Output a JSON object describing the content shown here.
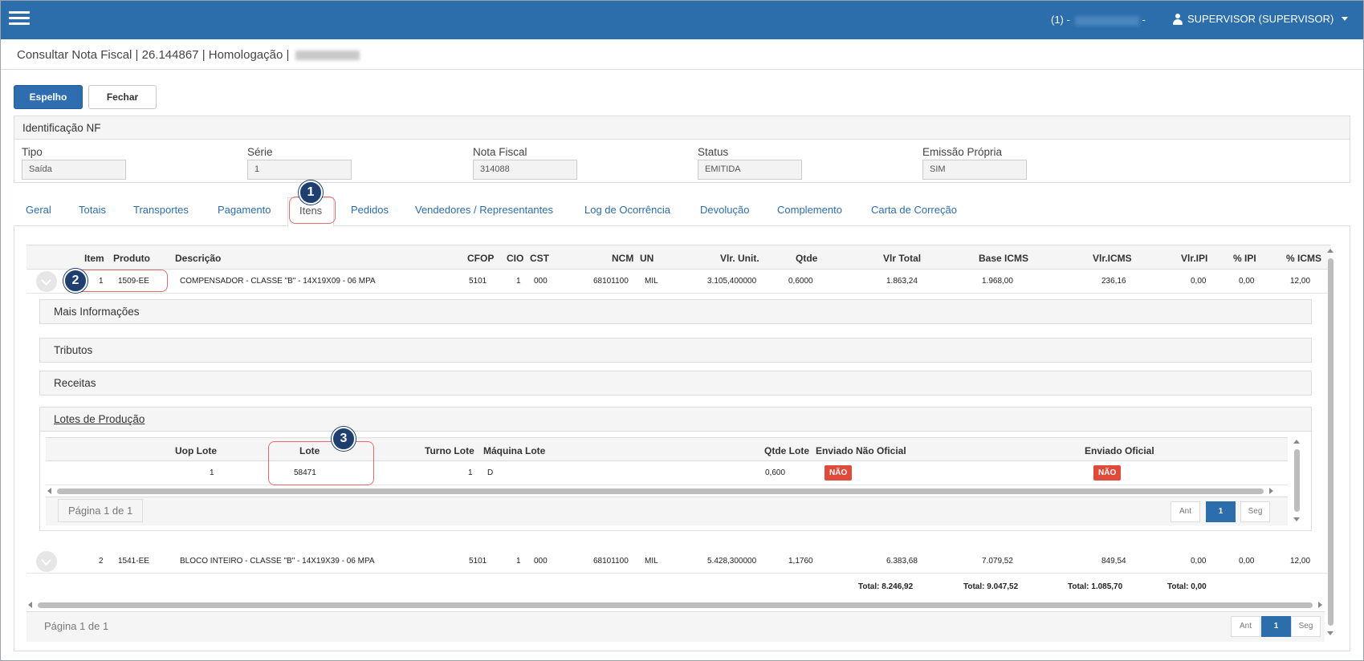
{
  "header": {
    "company_prefix": "(1) -",
    "company_suffix": "-",
    "user": "SUPERVISOR (SUPERVISOR)"
  },
  "title": {
    "text": "Consultar Nota Fiscal | 26.144867 | Homologação |"
  },
  "toolbar": {
    "espelho": "Espelho",
    "fechar": "Fechar"
  },
  "identificacao": {
    "heading": "Identificação NF",
    "fields": [
      {
        "label": "Tipo",
        "value": "Saída"
      },
      {
        "label": "Série",
        "value": "1"
      },
      {
        "label": "Nota Fiscal",
        "value": "314088"
      },
      {
        "label": "Status",
        "value": "EMITIDA"
      },
      {
        "label": "Emissão Própria",
        "value": "SIM"
      }
    ]
  },
  "tabs": [
    "Geral",
    "Totais",
    "Transportes",
    "Pagamento",
    "Itens",
    "Pedidos",
    "Vendedores / Representantes",
    "Log de Ocorrência",
    "Devolução",
    "Complemento",
    "Carta de Correção"
  ],
  "markers": [
    "1",
    "2",
    "3"
  ],
  "items": {
    "columns": [
      "Item",
      "Produto",
      "Descrição",
      "CFOP",
      "CIO",
      "CST",
      "NCM",
      "UN",
      "Vlr. Unit.",
      "Qtde",
      "Vlr Total",
      "Base ICMS",
      "Vlr.ICMS",
      "Vlr.IPI",
      "% IPI",
      "% ICMS"
    ],
    "rows": [
      {
        "item": "1",
        "produto": "1509-EE",
        "descricao": "COMPENSADOR - CLASSE \"B\" - 14X19X09 - 06 MPA",
        "cfop": "5101",
        "cio": "1",
        "cst": "000",
        "ncm": "68101100",
        "un": "MIL",
        "vlr_unit": "3.105,400000",
        "qtde": "0,6000",
        "vlr_total": "1.863,24",
        "base_icms": "1.968,00",
        "vlr_icms": "236,16",
        "vlr_ipi": "0,00",
        "pct_ipi": "0,00",
        "pct_icms": "12,00"
      },
      {
        "item": "2",
        "produto": "1541-EE",
        "descricao": "BLOCO INTEIRO - CLASSE \"B\" - 14X19X39 - 06 MPA",
        "cfop": "5101",
        "cio": "1",
        "cst": "000",
        "ncm": "68101100",
        "un": "MIL",
        "vlr_unit": "5.428,300000",
        "qtde": "1,1760",
        "vlr_total": "6.383,68",
        "base_icms": "7.079,52",
        "vlr_icms": "849,54",
        "vlr_ipi": "0,00",
        "pct_ipi": "0,00",
        "pct_icms": "12,00"
      }
    ],
    "totals": {
      "vlr_total": "Total: 8.246,92",
      "base_icms": "Total: 9.047,52",
      "vlr_icms": "Total: 1.085,70",
      "vlr_ipi": "Total: 0,00"
    },
    "accordions": [
      "Mais Informações",
      "Tributos",
      "Receitas"
    ],
    "page_info": "Página 1 de 1",
    "pager": {
      "prev": "Ant",
      "current": "1",
      "next": "Seg"
    }
  },
  "lotes": {
    "heading": "Lotes de Produção",
    "columns": [
      "Uop Lote",
      "Lote",
      "Turno Lote",
      "Máquina Lote",
      "Qtde Lote",
      "Enviado Não Oficial",
      "Enviado Oficial"
    ],
    "row": {
      "uop": "1",
      "lote": "58471",
      "turno": "1",
      "maquina": "D",
      "qtde": "0,600",
      "nao_oficial": "NÃO",
      "oficial": "NÃO"
    },
    "page_info": "Página 1 de 1",
    "pager": {
      "prev": "Ant",
      "current": "1",
      "next": "Seg"
    }
  },
  "colors": {
    "primary": "#2c6dac",
    "marker": "#1e3f6f",
    "danger": "#e04a3a",
    "highlight": "#e46b6b"
  }
}
